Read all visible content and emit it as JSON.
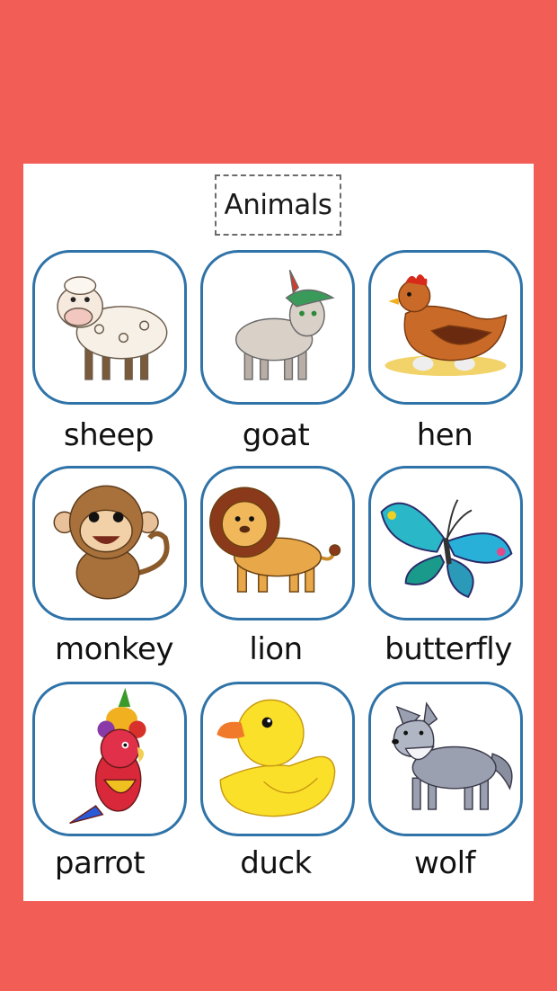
{
  "title": "Animals",
  "colors": {
    "background": "#f25e56",
    "card_border": "#2f73a8",
    "sheet": "#ffffff"
  },
  "animals": [
    {
      "label": "sheep",
      "icon": "sheep-icon"
    },
    {
      "label": "goat",
      "icon": "goat-icon"
    },
    {
      "label": "hen",
      "icon": "hen-icon"
    },
    {
      "label": "monkey",
      "icon": "monkey-icon"
    },
    {
      "label": "lion",
      "icon": "lion-icon"
    },
    {
      "label": "butterfly",
      "icon": "butterfly-icon"
    },
    {
      "label": "parrot",
      "icon": "parrot-icon"
    },
    {
      "label": "duck",
      "icon": "duck-icon"
    },
    {
      "label": "wolf",
      "icon": "wolf-icon"
    }
  ]
}
